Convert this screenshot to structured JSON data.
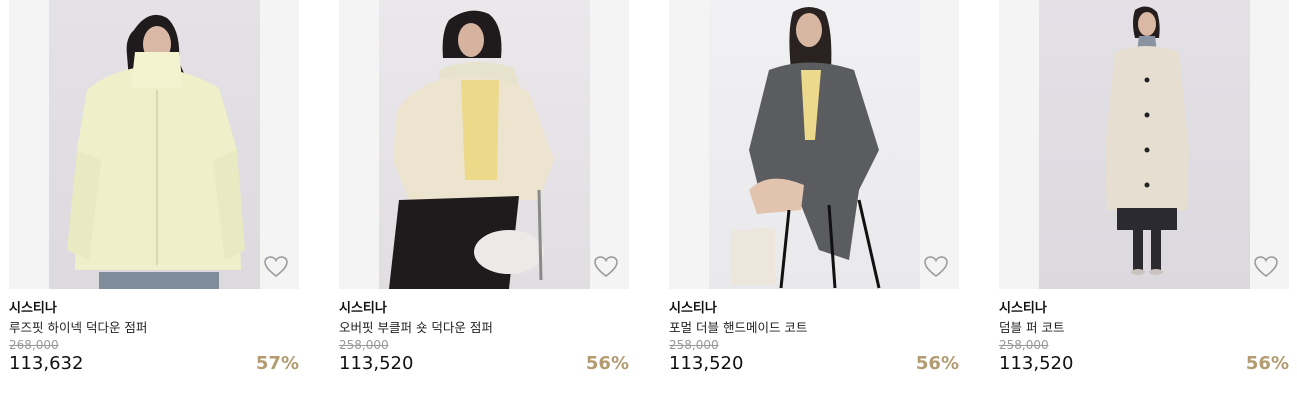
{
  "products": [
    {
      "brand": "시스티나",
      "name": "루즈핏 하이넥 덕다운 점퍼",
      "original_price": "268,000",
      "price": "113,632",
      "discount": "57%",
      "image": "model in light yellow high-neck puffer jacket",
      "wishlist_icon": "heart-outline-icon"
    },
    {
      "brand": "시스티나",
      "name": "오버핏 부클퍼 숏 덕다운 점퍼",
      "original_price": "258,000",
      "price": "113,520",
      "discount": "56%",
      "image": "model seated in cream short puffer with fur collar",
      "wishlist_icon": "heart-outline-icon"
    },
    {
      "brand": "시스티나",
      "name": "포멀 더블 핸드메이드 코트",
      "original_price": "258,000",
      "price": "113,520",
      "discount": "56%",
      "image": "model seated in grey double-breasted coat",
      "wishlist_icon": "heart-outline-icon"
    },
    {
      "brand": "시스티나",
      "name": "덤블 퍼 코트",
      "original_price": "258,000",
      "price": "113,520",
      "discount": "56%",
      "image": "model standing in long beige fleece coat",
      "wishlist_icon": "heart-outline-icon"
    }
  ],
  "colors": {
    "discount": "#b39b72",
    "original_price": "#9a9a9a",
    "thumb_bg": "#f4f4f4"
  }
}
